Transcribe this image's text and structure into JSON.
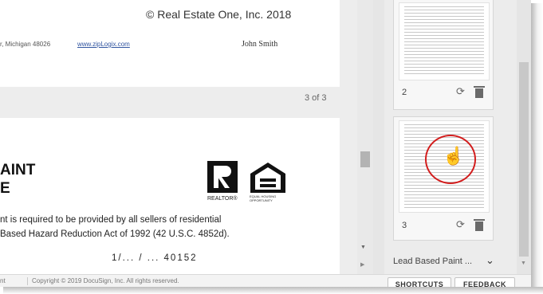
{
  "document": {
    "copyright": "© Real Estate One, Inc. 2018",
    "address_fragment": "r, Michigan 48026",
    "website": "www.zipLogix.com",
    "agent_name": "John Smith",
    "page_indicator": "3 of 3",
    "heading_line1": "AINT",
    "heading_line2": "E",
    "realtor_caption": "REALTOR®",
    "eho_caption": "EQUAL HOUSING OPPORTUNITY",
    "body_line1": "nt is required to be provided by all sellers of residential",
    "body_line2": "Based Hazard Reduction Act of 1992 (42 U.S.C. 4852d).",
    "body_line3": "1/... / ...    40152"
  },
  "thumbnails": [
    {
      "page_number": "2"
    },
    {
      "page_number": "3"
    }
  ],
  "panel": {
    "dropdown_label": "Lead Based Paint ...",
    "highlight_color": "#d21d1d"
  },
  "footer": {
    "left_fragment": "nt",
    "copyright": "Copyright © 2019 DocuSign, Inc. All rights reserved.",
    "shortcuts_label": "SHORTCUTS",
    "feedback_label": "FEEDBACK"
  },
  "icons": {
    "rotate": "rotate-page-icon",
    "delete": "trash-icon",
    "pointer": "hand-pointer-icon",
    "chevron": "chevron-down-icon"
  }
}
